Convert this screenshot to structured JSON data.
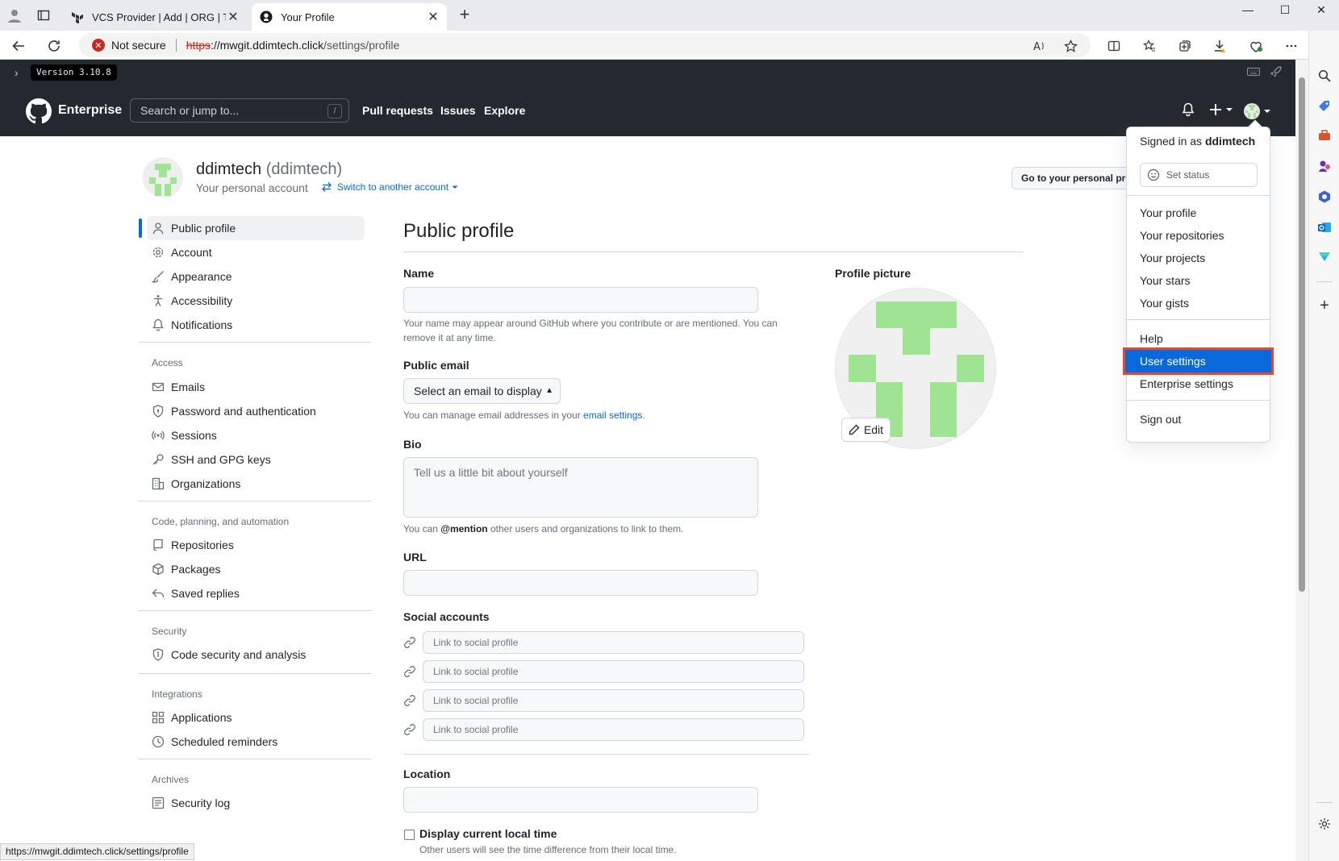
{
  "browser": {
    "tabs": [
      {
        "title": "VCS Provider | Add | ORG | Terraf",
        "active": false
      },
      {
        "title": "Your Profile",
        "active": true
      }
    ],
    "security_label": "Not secure",
    "url_scheme": "https",
    "url_host": "://mwgit.ddimtech.click",
    "url_path": "/settings/profile",
    "status_url": "https://mwgit.ddimtech.click/settings/profile"
  },
  "ghe": {
    "version": "Version 3.10.8",
    "brand": "Enterprise",
    "search_placeholder": "Search or jump to...",
    "search_shortcut": "/",
    "nav": [
      "Pull requests",
      "Issues",
      "Explore"
    ]
  },
  "account": {
    "name": "ddimtech",
    "login": "(ddimtech)",
    "subtitle": "Your personal account",
    "switch_label": "Switch to another account",
    "goto_label": "Go to your personal profile"
  },
  "sidebar": {
    "top": [
      {
        "label": "Public profile",
        "icon": "person-icon",
        "active": true
      },
      {
        "label": "Account",
        "icon": "gear-icon"
      },
      {
        "label": "Appearance",
        "icon": "paintbrush-icon"
      },
      {
        "label": "Accessibility",
        "icon": "accessibility-icon"
      },
      {
        "label": "Notifications",
        "icon": "bell-icon"
      }
    ],
    "access_title": "Access",
    "access": [
      {
        "label": "Emails",
        "icon": "mail-icon"
      },
      {
        "label": "Password and authentication",
        "icon": "shield-lock-icon"
      },
      {
        "label": "Sessions",
        "icon": "broadcast-icon"
      },
      {
        "label": "SSH and GPG keys",
        "icon": "key-icon"
      },
      {
        "label": "Organizations",
        "icon": "organization-icon"
      }
    ],
    "code_title": "Code, planning, and automation",
    "code": [
      {
        "label": "Repositories",
        "icon": "repo-icon"
      },
      {
        "label": "Packages",
        "icon": "package-icon"
      },
      {
        "label": "Saved replies",
        "icon": "reply-icon"
      }
    ],
    "security_title": "Security",
    "security": [
      {
        "label": "Code security and analysis",
        "icon": "shield-check-icon"
      }
    ],
    "integrations_title": "Integrations",
    "integrations": [
      {
        "label": "Applications",
        "icon": "apps-icon"
      },
      {
        "label": "Scheduled reminders",
        "icon": "clock-icon"
      }
    ],
    "archives_title": "Archives",
    "archives": [
      {
        "label": "Security log",
        "icon": "log-icon"
      }
    ]
  },
  "profile_form": {
    "title": "Public profile",
    "name_label": "Name",
    "name_value": "",
    "name_note": "Your name may appear around GitHub where you contribute or are mentioned. You can remove it at any time.",
    "email_label": "Public email",
    "email_select": "Select an email to display",
    "email_note_prefix": "You can manage email addresses in your ",
    "email_note_link": "email settings",
    "email_note_suffix": ".",
    "bio_label": "Bio",
    "bio_placeholder": "Tell us a little bit about yourself",
    "bio_note_prefix": "You can ",
    "bio_note_mention": "@mention",
    "bio_note_suffix": " other users and organizations to link to them.",
    "url_label": "URL",
    "url_value": "",
    "social_label": "Social accounts",
    "social_placeholder": "Link to social profile",
    "location_label": "Location",
    "location_value": "",
    "local_time_label": "Display current local time",
    "local_time_note": "Other users will see the time difference from their local time.",
    "picture_label": "Profile picture",
    "edit_label": "Edit"
  },
  "user_menu": {
    "signed_in_prefix": "Signed in as ",
    "signed_in_user": "ddimtech",
    "set_status": "Set status",
    "items_a": [
      "Your profile",
      "Your repositories",
      "Your projects",
      "Your stars",
      "Your gists"
    ],
    "items_b": [
      "Help",
      "User settings",
      "Enterprise settings"
    ],
    "highlighted": "User settings",
    "sign_out": "Sign out"
  },
  "colors": {
    "header_bg": "#24292f",
    "link": "#0969da",
    "identicon": "#9ee493",
    "highlight_outline": "#e5482b"
  }
}
